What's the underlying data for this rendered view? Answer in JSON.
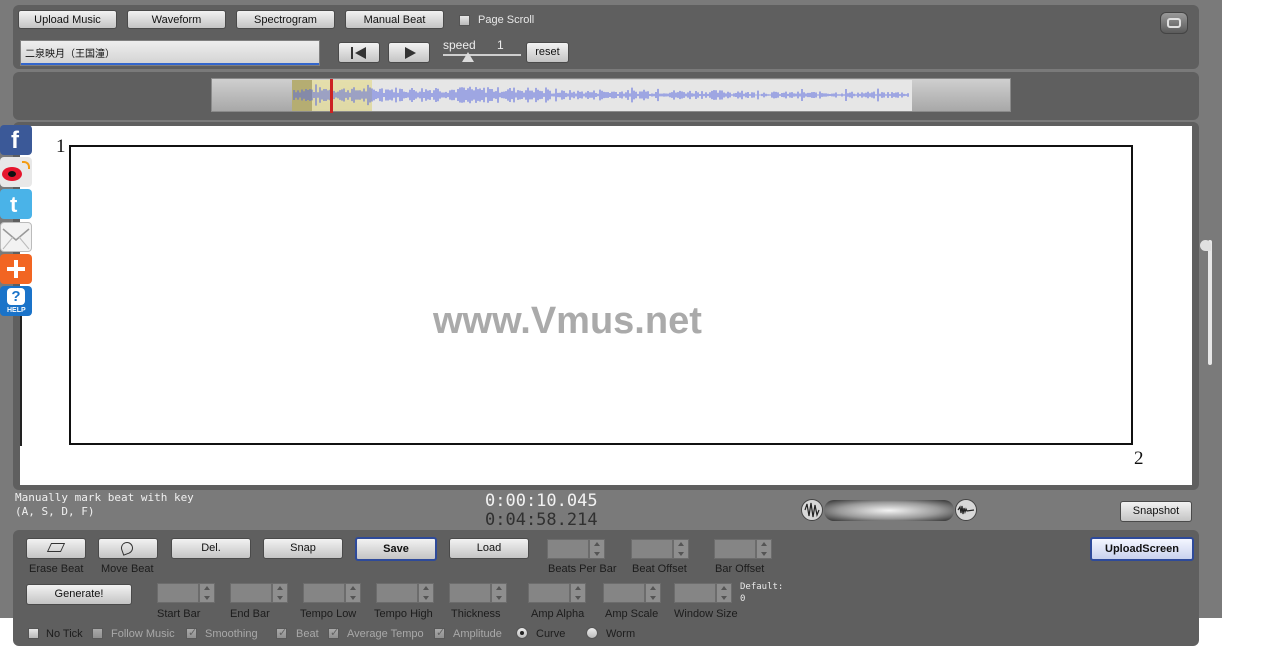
{
  "toolbar": {
    "upload_music": "Upload Music",
    "waveform": "Waveform",
    "spectrogram": "Spectrogram",
    "manual_beat": "Manual Beat",
    "page_scroll": "Page Scroll",
    "song_title": "二泉映月（王国潼）",
    "speed_label": "speed",
    "speed_value": "1",
    "reset": "reset"
  },
  "canvas": {
    "watermark": "www.Vmus.net",
    "corner_start": "1",
    "corner_end": "2"
  },
  "status": {
    "hint_line1": "Manually mark beat with key",
    "hint_line2": "(A, S, D, F)",
    "current_time": "0:00:10.045",
    "total_time": "0:04:58.214",
    "snapshot": "Snapshot"
  },
  "editor": {
    "erase_beat": "Erase Beat",
    "move_beat": "Move Beat",
    "del": "Del.",
    "snap": "Snap",
    "save": "Save",
    "load": "Load",
    "beats_per_bar": "Beats Per Bar",
    "beat_offset": "Beat Offset",
    "bar_offset": "Bar Offset",
    "upload_screen": "UploadScreen",
    "generate": "Generate!",
    "start_bar": "Start Bar",
    "end_bar": "End Bar",
    "tempo_low": "Tempo Low",
    "tempo_high": "Tempo High",
    "thickness": "Thickness",
    "amp_alpha": "Amp Alpha",
    "amp_scale": "Amp Scale",
    "window_size": "Window Size",
    "default_label": "Default:",
    "default_value": "0"
  },
  "options": {
    "no_tick": "No Tick",
    "follow_music": "Follow Music",
    "smoothing": "Smoothing",
    "beat": "Beat",
    "average_tempo": "Average Tempo",
    "amplitude": "Amplitude",
    "curve": "Curve",
    "worm": "Worm"
  },
  "social": {
    "icons": [
      "facebook-icon",
      "weibo-icon",
      "twitter-icon",
      "email-icon",
      "share-plus-icon",
      "help-icon"
    ],
    "help_text": "HELP"
  },
  "colors": {
    "accent_blue": "#3355aa",
    "waveform": "#5566dd",
    "playhead": "#cc2222"
  }
}
